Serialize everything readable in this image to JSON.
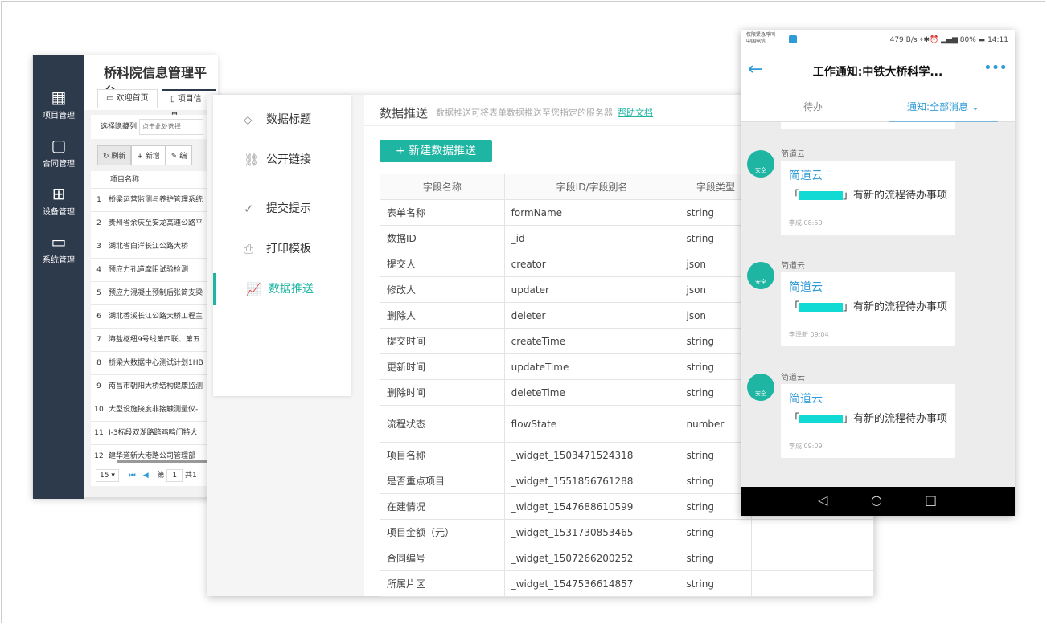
{
  "admin": {
    "title": "桥科院信息管理平台",
    "sidebar": [
      {
        "icon": "calendar-icon",
        "label": "项目管理"
      },
      {
        "icon": "note-icon",
        "label": "合同管理"
      },
      {
        "icon": "basket-icon",
        "label": "设备管理"
      },
      {
        "icon": "monitor-icon",
        "label": "系统管理"
      }
    ],
    "tabs": [
      "欢迎首页",
      "项目信息"
    ],
    "hide_col_label": "选择隐藏列",
    "hide_col_placeholder": "点击此处选择",
    "toolbar": [
      "刷新",
      "新增",
      "编"
    ],
    "column": "项目名称",
    "rows": [
      "桥梁运营监测与养护管理系统",
      "贵州省余庆至安龙高速公路平",
      "湖北省白洋长江公路大桥",
      "预应力孔道摩阻试验检测",
      "预应力混凝土预制后张简支梁",
      "湖北香溪长江公路大桥工程主",
      "海盐枢纽9号线第四联、第五",
      "桥梁大数据中心测试计划1HB",
      "南昌市朝阳大桥结构健康监测",
      "大型设施挠度非接触测量仪-",
      "Ⅰ-3标段双湖路跨鸡鸣门特大",
      "建华道新大港路公司管理部"
    ],
    "pager": {
      "size": "15 ▾",
      "page_label": "第",
      "page": "1",
      "total": "共1"
    }
  },
  "form": {
    "menu": [
      {
        "icon": "tag-icon",
        "label": "数据标题"
      },
      {
        "icon": "link-icon",
        "label": "公开链接"
      },
      {
        "icon": "check-circle-icon",
        "label": "提交提示"
      },
      {
        "icon": "printer-icon",
        "label": "打印模板"
      },
      {
        "icon": "chart-icon",
        "label": "数据推送",
        "active": true
      }
    ],
    "title": "数据推送",
    "desc": "数据推送可将表单数据推送至您指定的服务器",
    "help": "帮助文档",
    "new_button": "+ 新建数据推送",
    "headers": [
      "字段名称",
      "字段ID/字段别名",
      "字段类型",
      ""
    ],
    "rows": [
      [
        "表单名称",
        "formName",
        "string"
      ],
      [
        "数据ID",
        "_id",
        "string"
      ],
      [
        "提交人",
        "creator",
        "json"
      ],
      [
        "修改人",
        "updater",
        "json"
      ],
      [
        "删除人",
        "deleter",
        "json"
      ],
      [
        "提交时间",
        "createTime",
        "string"
      ],
      [
        "更新时间",
        "updateTime",
        "string"
      ],
      [
        "删除时间",
        "deleteTime",
        "string"
      ],
      [
        "流程状态",
        "flowState",
        "number"
      ],
      [
        "项目名称",
        "_widget_1503471524318",
        "string"
      ],
      [
        "是否重点项目",
        "_widget_1551856761288",
        "string"
      ],
      [
        "在建情况",
        "_widget_1547688610599",
        "string"
      ],
      [
        "项目金额（元）",
        "_widget_1531730853465",
        "string"
      ],
      [
        "合同编号",
        "_widget_1507266200252",
        "string"
      ],
      [
        "所属片区",
        "_widget_1547536614857",
        "string"
      ]
    ],
    "accent": "#1fb5a3"
  },
  "phone": {
    "status": {
      "carrier1": "仅限紧急呼叫",
      "carrier2": "中国电信",
      "speed": "479 B/s",
      "battery": "80%",
      "time": "14:11"
    },
    "title": "工作通知:中铁大桥科学...",
    "tabs": [
      "待办",
      "通知:全部消息"
    ],
    "messages": [
      {
        "sender": "简道云",
        "title": "简道云",
        "body_prefix": "「",
        "body_suffix": "」有新的流程待办事项",
        "meta": "李成 08:50"
      },
      {
        "sender": "简道云",
        "title": "简道云",
        "body_prefix": "「",
        "body_suffix": "」有新的流程待办事项",
        "meta": "李泽新 09:04"
      },
      {
        "sender": "简道云",
        "title": "简道云",
        "body_prefix": "「",
        "body_suffix": "」有新的流程待办事项",
        "meta": "李成 09:09"
      }
    ],
    "avatar_text": "安全"
  }
}
